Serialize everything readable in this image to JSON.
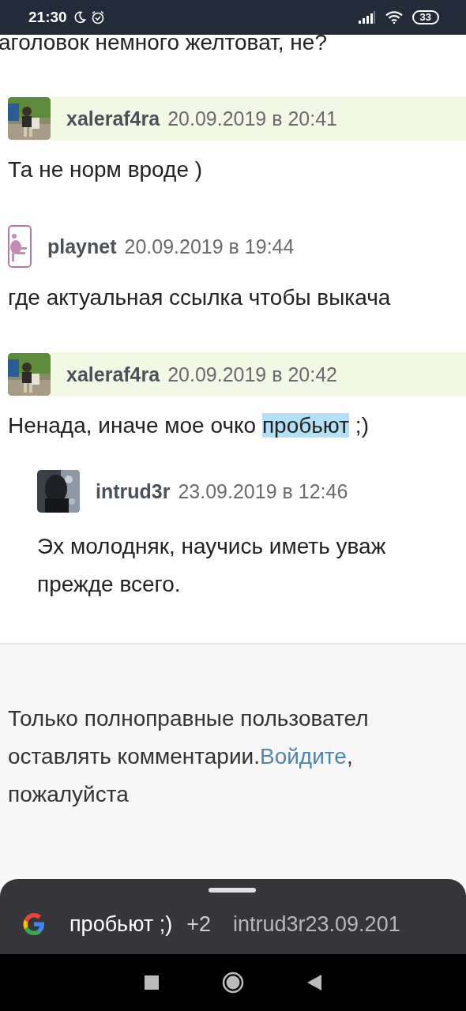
{
  "status_bar": {
    "time": "21:30",
    "battery": "33"
  },
  "top_text": "аголовок немного желтоват, не?",
  "comments": [
    {
      "author": "xaleraf4ra",
      "date": "20.09.2019 в 20:41",
      "highlighted": true,
      "lines": [
        [
          {
            "text": "Та не норм вроде )",
            "selected": false
          }
        ]
      ]
    },
    {
      "author": "playnet",
      "date": "20.09.2019 в 19:44",
      "highlighted": false,
      "lines": [
        [
          {
            "text": "где актуальная ссылка чтобы выкача",
            "selected": false
          }
        ]
      ]
    },
    {
      "author": "xaleraf4ra",
      "date": "20.09.2019 в 20:42",
      "highlighted": true,
      "lines": [
        [
          {
            "text": "Ненада, иначе мое очко ",
            "selected": false
          },
          {
            "text": "пробьют",
            "selected": true
          },
          {
            "text": " ;)",
            "selected": false
          }
        ]
      ],
      "children": [
        {
          "author": "intrud3r",
          "date": "23.09.2019 в 12:46",
          "highlighted": false,
          "lines": [
            [
              {
                "text": "Эх молодняк, научись иметь уваж",
                "selected": false
              }
            ],
            [
              {
                "text": "прежде всего.",
                "selected": false
              }
            ]
          ]
        }
      ]
    }
  ],
  "notice": {
    "line1": "Только полноправные пользовател",
    "line2": "оставлять комментарии.",
    "link": "Войдите",
    "after_link": ",",
    "line3": "пожалуйста"
  },
  "search_sheet": {
    "query": "пробьют ;)",
    "more": "+2",
    "suggestion": "intrud3r23.09.201"
  }
}
